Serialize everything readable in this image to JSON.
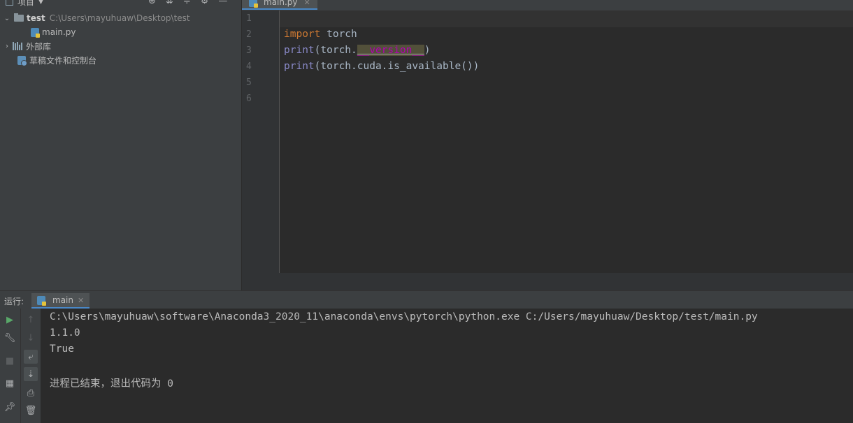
{
  "project": {
    "header_label": "项目",
    "root": {
      "name": "test",
      "path": "C:\\Users\\mayuhuaw\\Desktop\\test"
    },
    "file": "main.py",
    "external_libs": "外部库",
    "scratches": "草稿文件和控制台"
  },
  "editor": {
    "tab": "main.py",
    "line_numbers": [
      "1",
      "2",
      "3",
      "4",
      "5",
      "6"
    ],
    "code": {
      "l2_kw": "import",
      "l2_rest": " torch",
      "l3_fn": "print",
      "l3_a": "(torch.",
      "l3_attr": "__version__",
      "l3_b": ")",
      "l4_fn": "print",
      "l4_rest": "(torch.cuda.is_available())"
    }
  },
  "run": {
    "label": "运行:",
    "tab": "main",
    "output": [
      "C:\\Users\\mayuhuaw\\software\\Anaconda3_2020_11\\anaconda\\envs\\pytorch\\python.exe C:/Users/mayuhuaw/Desktop/test/main.py",
      "1.1.0",
      "True",
      "",
      "进程已结束，退出代码为 0"
    ]
  },
  "colors": {
    "accent": "#4a88c7",
    "keyword": "#cc7832",
    "builtin": "#8888c6",
    "dunder": "#b200b2"
  }
}
